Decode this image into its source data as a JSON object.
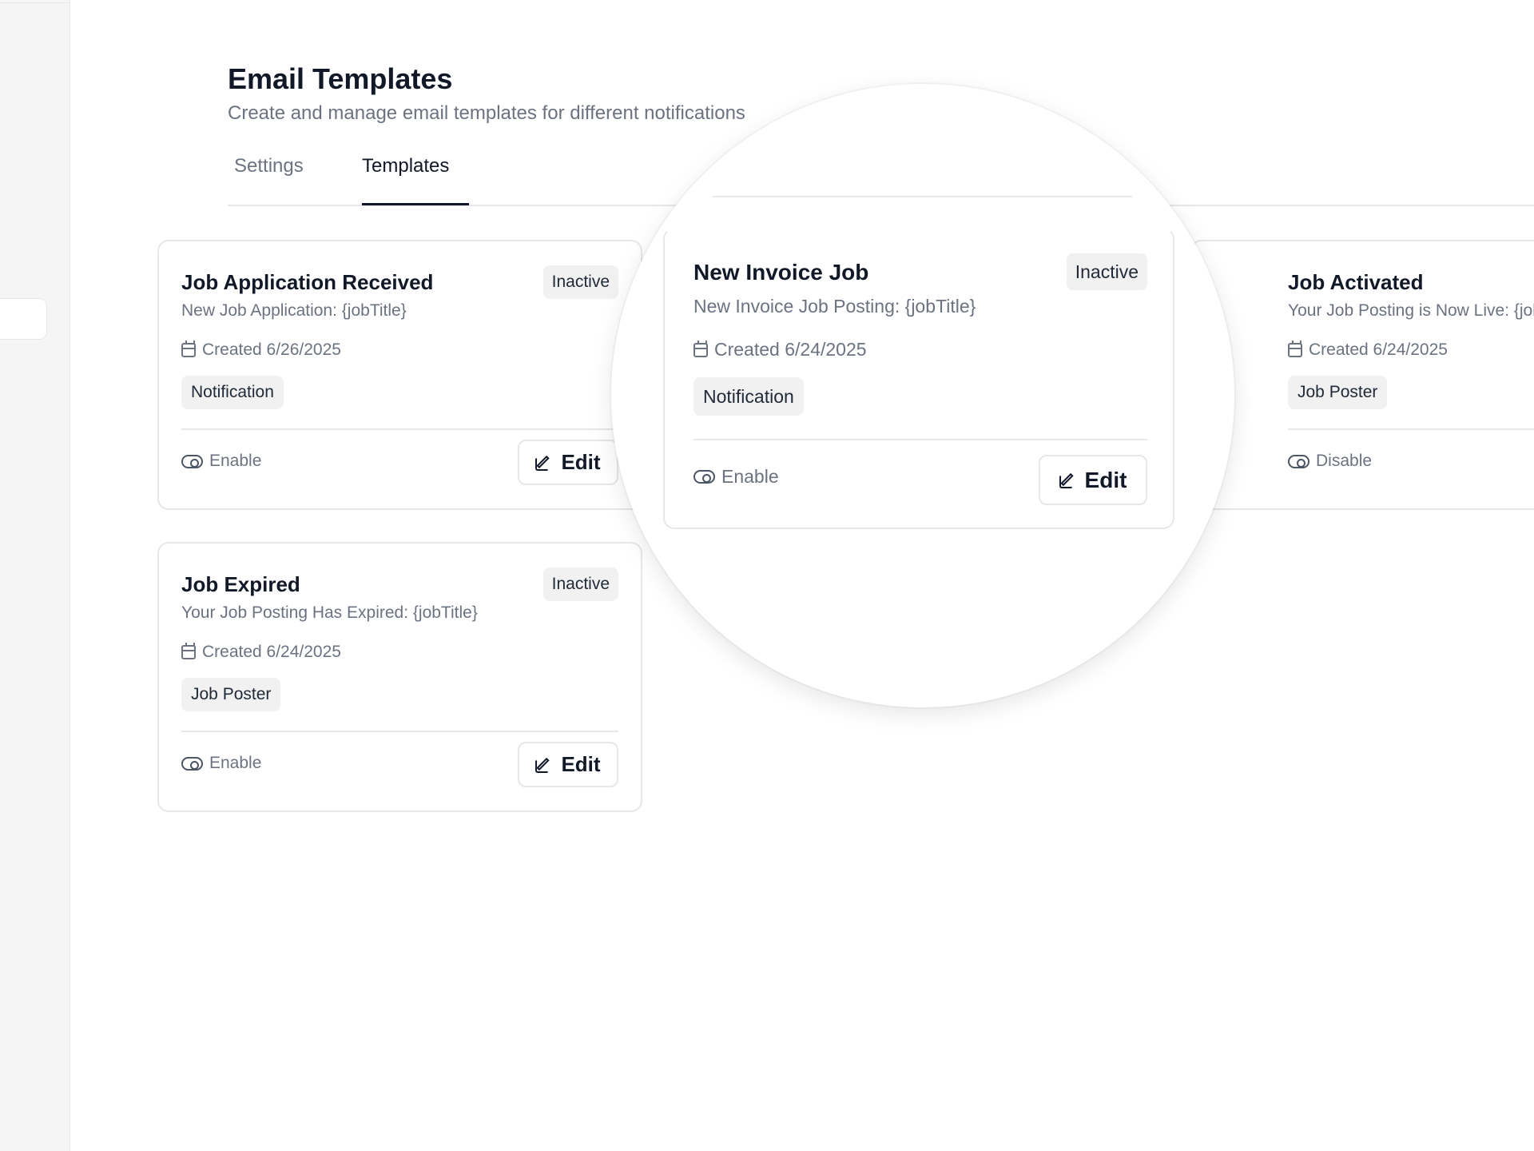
{
  "page": {
    "title": "Email Templates",
    "subtitle": "Create and manage email templates for different notifications"
  },
  "tabs": [
    {
      "label": "Settings",
      "active": false
    },
    {
      "label": "Templates",
      "active": true
    }
  ],
  "templates": [
    {
      "title": "Job Application Received",
      "subject": "New Job Application: {jobTitle}",
      "created": "Created 6/26/2025",
      "category": "Notification",
      "status": "Inactive",
      "toggle_label": "Enable",
      "edit_label": "Edit"
    },
    {
      "title": "New Invoice Job",
      "subject": "New Invoice Job Posting: {jobTitle}",
      "created": "Created 6/24/2025",
      "category": "Notification",
      "status": "Inactive",
      "toggle_label": "Enable",
      "edit_label": "Edit"
    },
    {
      "title": "Job Activated",
      "subject": "Your Job Posting is Now Live: {jobTitle}",
      "created": "Created 6/24/2025",
      "category": "Job Poster",
      "toggle_label": "Disable"
    },
    {
      "title": "Job Expired",
      "subject": "Your Job Posting Has Expired: {jobTitle}",
      "created": "Created 6/24/2025",
      "category": "Job Poster",
      "status": "Inactive",
      "toggle_label": "Enable",
      "edit_label": "Edit"
    }
  ],
  "colors": {
    "accent": "#111827",
    "muted_text": "#6b7280",
    "border": "#e5e7eb",
    "chip_bg": "#f1f1f2"
  },
  "icons": {
    "created": "calendar-icon",
    "toggle": "toggle-icon",
    "edit": "edit-icon"
  }
}
